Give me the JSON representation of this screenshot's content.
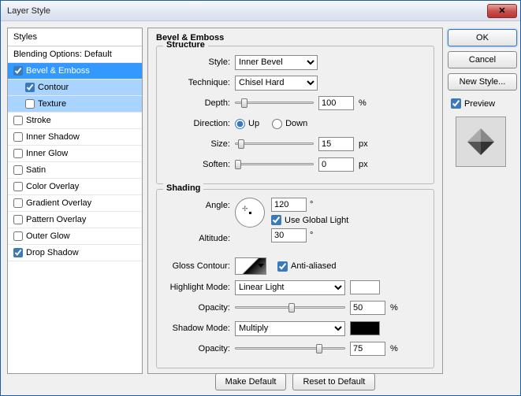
{
  "title": "Layer Style",
  "left": {
    "header": "Styles",
    "blending": "Blending Options: Default",
    "items": [
      {
        "label": "Bevel & Emboss",
        "checked": true,
        "sel": true,
        "sub": false
      },
      {
        "label": "Contour",
        "checked": true,
        "sel": false,
        "sub": true,
        "subsel": true
      },
      {
        "label": "Texture",
        "checked": false,
        "sel": false,
        "sub": true,
        "subsel": true
      },
      {
        "label": "Stroke",
        "checked": false
      },
      {
        "label": "Inner Shadow",
        "checked": false
      },
      {
        "label": "Inner Glow",
        "checked": false
      },
      {
        "label": "Satin",
        "checked": false
      },
      {
        "label": "Color Overlay",
        "checked": false
      },
      {
        "label": "Gradient Overlay",
        "checked": false
      },
      {
        "label": "Pattern Overlay",
        "checked": false
      },
      {
        "label": "Outer Glow",
        "checked": false
      },
      {
        "label": "Drop Shadow",
        "checked": true
      }
    ]
  },
  "main_title": "Bevel & Emboss",
  "structure": {
    "legend": "Structure",
    "style_label": "Style:",
    "style_value": "Inner Bevel",
    "tech_label": "Technique:",
    "tech_value": "Chisel Hard",
    "depth_label": "Depth:",
    "depth_value": "100",
    "depth_unit": "%",
    "dir_label": "Direction:",
    "up": "Up",
    "down": "Down",
    "size_label": "Size:",
    "size_value": "15",
    "size_unit": "px",
    "soften_label": "Soften:",
    "soften_value": "0",
    "soften_unit": "px"
  },
  "shading": {
    "legend": "Shading",
    "angle_label": "Angle:",
    "angle_value": "120",
    "deg": "°",
    "global": "Use Global Light",
    "alt_label": "Altitude:",
    "alt_value": "30",
    "gloss_label": "Gloss Contour:",
    "aa": "Anti-aliased",
    "hl_label": "Highlight Mode:",
    "hl_value": "Linear Light",
    "hl_color": "#ffffff",
    "hl_op_label": "Opacity:",
    "hl_op_value": "50",
    "pct": "%",
    "sh_label": "Shadow Mode:",
    "sh_value": "Multiply",
    "sh_color": "#000000",
    "sh_op_label": "Opacity:",
    "sh_op_value": "75"
  },
  "buttons": {
    "make": "Make Default",
    "reset": "Reset to Default",
    "ok": "OK",
    "cancel": "Cancel",
    "new": "New Style...",
    "preview": "Preview"
  }
}
